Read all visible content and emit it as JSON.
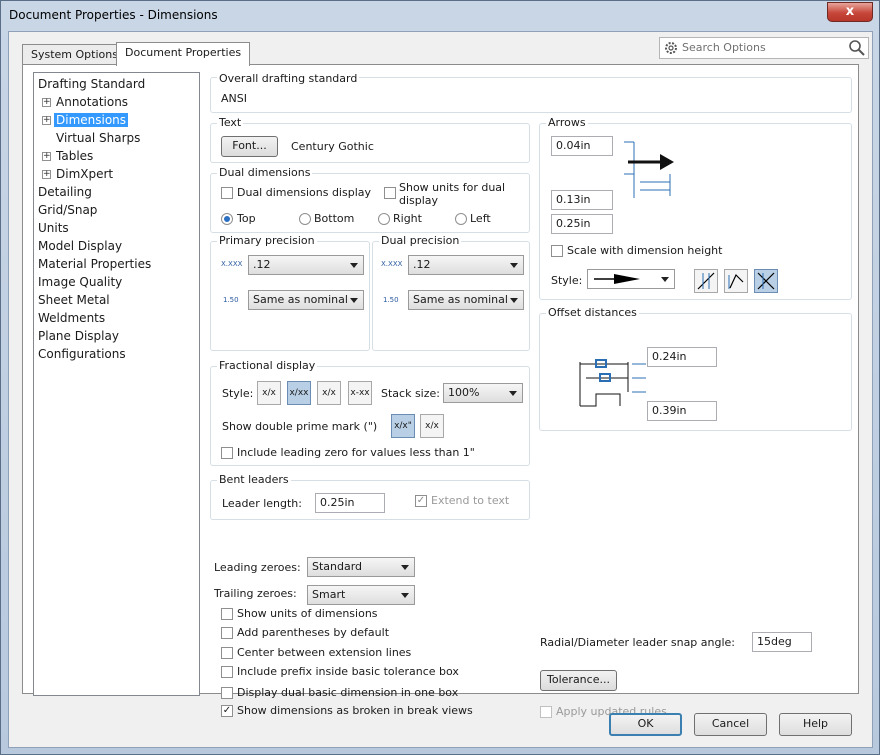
{
  "window": {
    "title": "Document Properties - Dimensions",
    "close_glyph": "x"
  },
  "tabs": [
    {
      "label": "System Options"
    },
    {
      "label": "Document Properties"
    }
  ],
  "search": {
    "placeholder": "Search Options"
  },
  "tree": {
    "items": [
      {
        "label": "Drafting Standard"
      },
      {
        "label": "Annotations"
      },
      {
        "label": "Dimensions"
      },
      {
        "label": "Virtual Sharps"
      },
      {
        "label": "Tables"
      },
      {
        "label": "DimXpert"
      },
      {
        "label": "Detailing"
      },
      {
        "label": "Grid/Snap"
      },
      {
        "label": "Units"
      },
      {
        "label": "Model Display"
      },
      {
        "label": "Material Properties"
      },
      {
        "label": "Image Quality"
      },
      {
        "label": "Sheet Metal"
      },
      {
        "label": "Weldments"
      },
      {
        "label": "Plane Display"
      },
      {
        "label": "Configurations"
      }
    ]
  },
  "overall": {
    "title": "Overall drafting standard",
    "value": "ANSI"
  },
  "text": {
    "title": "Text",
    "font_button": "Font...",
    "font_name": "Century Gothic"
  },
  "dual": {
    "title": "Dual dimensions",
    "display_label": "Dual dimensions display",
    "units_label_1": "Show units for dual",
    "units_label_2": "display",
    "pos_top": "Top",
    "pos_bottom": "Bottom",
    "pos_right": "Right",
    "pos_left": "Left"
  },
  "primary_precision": {
    "title": "Primary precision",
    "value": ".12",
    "tol": "Same as nominal",
    "icon_a": "X.XXX",
    "icon_b": "1.50"
  },
  "dual_precision": {
    "title": "Dual precision",
    "value": ".12",
    "tol": "Same as nominal",
    "icon_a": "X.XXX",
    "icon_b": "1.50"
  },
  "fractional": {
    "title": "Fractional display",
    "style_label": "Style:",
    "stack_label": "Stack size:",
    "stack_value": "100%",
    "double_prime_label": "Show double prime mark (\")",
    "leading_zero_label": "Include leading zero for values less than 1\"",
    "styles": [
      "x/x",
      "x/xx",
      "x/x",
      "x-xx"
    ],
    "prime_styles": [
      "x/x\"",
      "x/x"
    ]
  },
  "bent": {
    "title": "Bent leaders",
    "length_label": "Leader length:",
    "length_value": "0.25in",
    "extend_label": "Extend to text"
  },
  "leading_zeroes": {
    "label": "Leading zeroes:",
    "value": "Standard"
  },
  "trailing_zeroes": {
    "label": "Trailing zeroes:",
    "value": "Smart"
  },
  "checks": [
    {
      "label": "Show units of dimensions",
      "checked": false
    },
    {
      "label": "Add parentheses by default",
      "checked": false
    },
    {
      "label": "Center between extension lines",
      "checked": false
    },
    {
      "label": "Include prefix inside basic tolerance box",
      "checked": false
    },
    {
      "label": "Display dual basic dimension in one box",
      "checked": false
    },
    {
      "label": "Show dimensions as broken in break views",
      "checked": true
    }
  ],
  "arrows": {
    "title": "Arrows",
    "size1": "0.04in",
    "size2": "0.13in",
    "size3": "0.25in",
    "scale_label": "Scale with dimension height",
    "style_label": "Style:"
  },
  "offset": {
    "title": "Offset distances",
    "d1": "0.24in",
    "d2": "0.39in"
  },
  "radial": {
    "label": "Radial/Diameter leader snap angle:",
    "value": "15deg"
  },
  "tolerance_button": "Tolerance...",
  "apply_label": "Apply updated rules",
  "footer": {
    "ok": "OK",
    "cancel": "Cancel",
    "help": "Help"
  },
  "colors": {
    "selection": "#3399ff",
    "accent": "#3c7fb1",
    "close": "#c7473a"
  }
}
